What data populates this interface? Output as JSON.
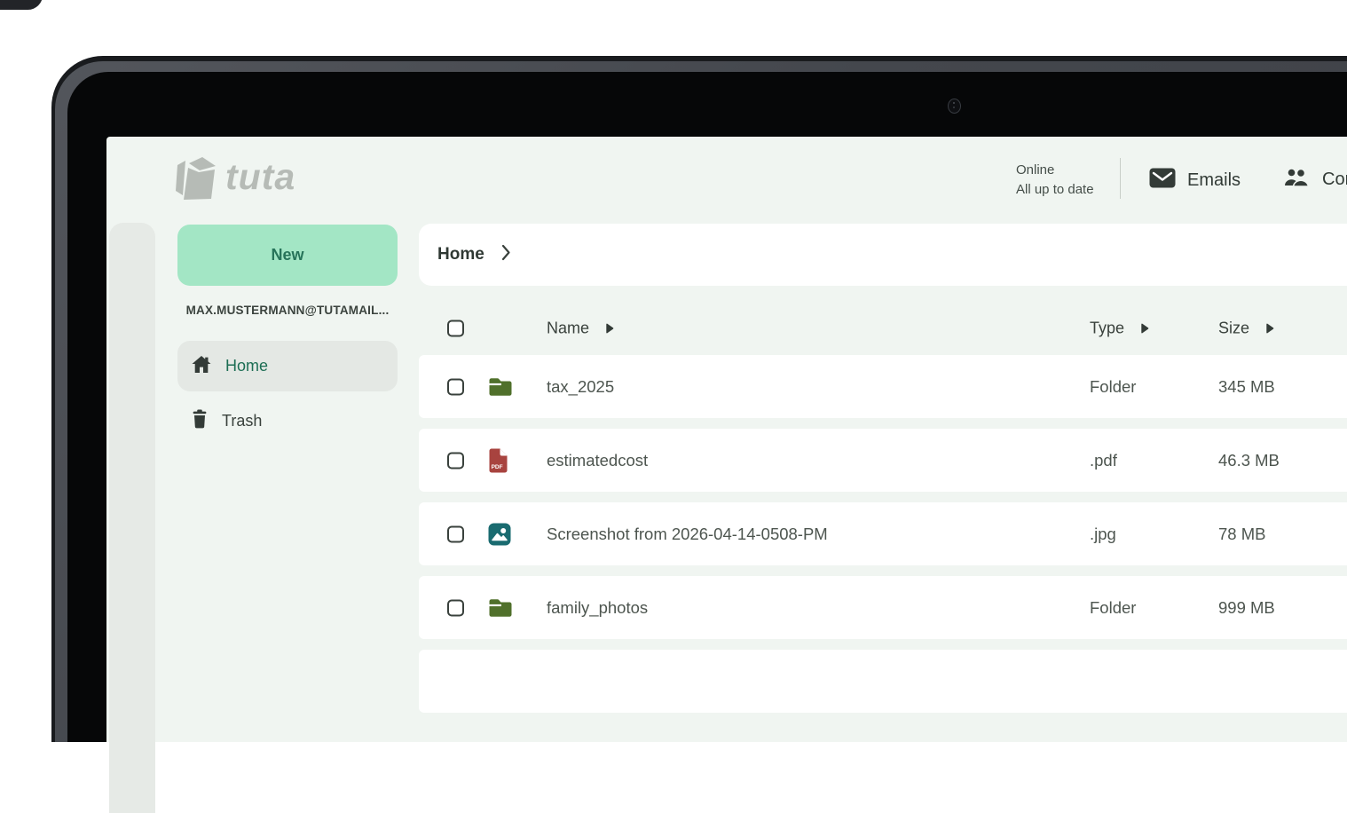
{
  "header": {
    "logo_text": "tuta",
    "status": {
      "line1": "Online",
      "line2": "All up to date"
    },
    "nav": [
      {
        "label": "Emails",
        "icon": "envelope-icon"
      },
      {
        "label": "Contacts",
        "icon": "people-icon"
      }
    ]
  },
  "sidebar": {
    "new_button": "New",
    "account": "MAX.MUSTERMANN@TUTAMAIL...",
    "items": [
      {
        "label": "Home",
        "icon": "home-icon",
        "selected": true
      },
      {
        "label": "Trash",
        "icon": "trash-icon",
        "selected": false
      }
    ]
  },
  "main": {
    "breadcrumb": "Home",
    "table": {
      "columns": [
        "Name",
        "Type",
        "Size"
      ],
      "rows": [
        {
          "name": "tax_2025",
          "type": "Folder",
          "size": "345 MB",
          "icon": "folder-icon"
        },
        {
          "name": "estimatedcost",
          "type": ".pdf",
          "size": "46.3 MB",
          "icon": "pdf-icon"
        },
        {
          "name": "Screenshot from 2026-04-14-0508-PM",
          "type": ".jpg",
          "size": "78 MB",
          "icon": "image-icon"
        },
        {
          "name": "family_photos",
          "type": "Folder",
          "size": "999 MB",
          "icon": "folder-icon"
        }
      ]
    }
  },
  "colors": {
    "accent_mint": "#a3e6c5",
    "accent_green_dark": "#27745a",
    "link_green": "#1d6e54",
    "page_bg": "#f0f5f1",
    "card_white": "#ffffff",
    "selected_item_bg": "#e4e8e4",
    "left_strip": "#e6eae6",
    "text_primary": "#39413c",
    "text_secondary": "#4d554f",
    "folder_green": "#50702b",
    "pdf_red": "#a8433f",
    "image_teal": "#1a6b70",
    "logo_gray": "#b6bbb6",
    "bezel_black": "#060708",
    "bezel_metal": "#46494f"
  }
}
